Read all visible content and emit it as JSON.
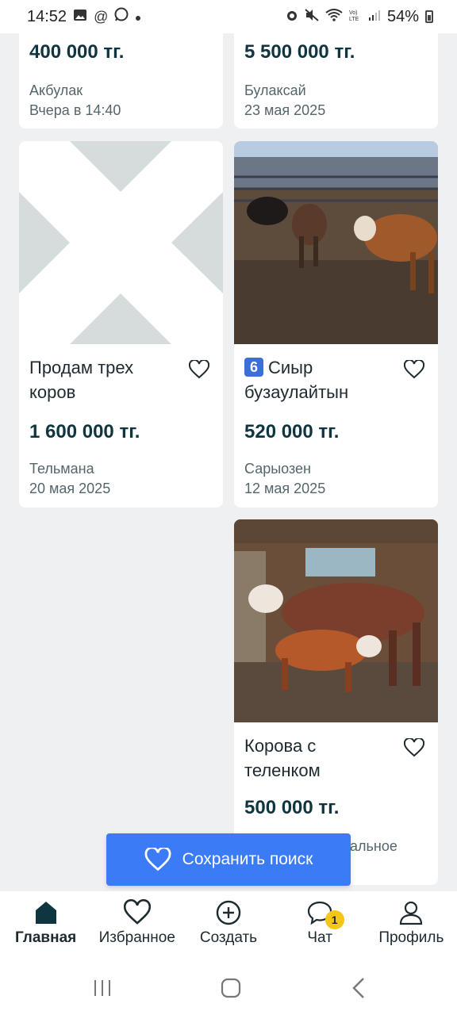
{
  "status_bar": {
    "time": "14:52",
    "battery": "54%",
    "icons": [
      "image-icon",
      "at-icon",
      "whatsapp-icon",
      "dot-icon",
      "alarm-icon",
      "mute-icon",
      "wifi-icon",
      "volte-icon",
      "signal-icon",
      "battery-icon"
    ]
  },
  "listings": [
    {
      "price": "400 000 тг.",
      "location": "Акбулак",
      "date": "Вчера в 14:40"
    },
    {
      "price": "5 500 000 тг.",
      "location": "Булаксай",
      "date": "23 мая 2025"
    },
    {
      "title": "Продам трех коров",
      "price": "1 600 000 тг.",
      "location": "Тельмана",
      "date": "20 мая 2025",
      "image": "placeholder-x"
    },
    {
      "badge": "6",
      "title": "Сиыр бузаулайтын",
      "price": "520 000 тг.",
      "location": "Сарыозен",
      "date": "12 мая 2025",
      "image": "cows-in-pen"
    },
    {
      "title": "Корова с теленком",
      "price": "500 000 тг.",
      "location_partial": "альное",
      "image": "cow-and-calf"
    }
  ],
  "save_search": {
    "label": "Сохранить поиск"
  },
  "bottom_nav": [
    {
      "label": "Главная",
      "icon": "home-icon",
      "active": true
    },
    {
      "label": "Избранное",
      "icon": "heart-icon"
    },
    {
      "label": "Создать",
      "icon": "plus-circle-icon"
    },
    {
      "label": "Чат",
      "icon": "chat-icon",
      "badge": "1"
    },
    {
      "label": "Профиль",
      "icon": "profile-icon"
    }
  ],
  "colors": {
    "accent": "#3b7bf5",
    "price": "#0f3540",
    "background": "#eef0f2",
    "badge": "#f5c518"
  }
}
